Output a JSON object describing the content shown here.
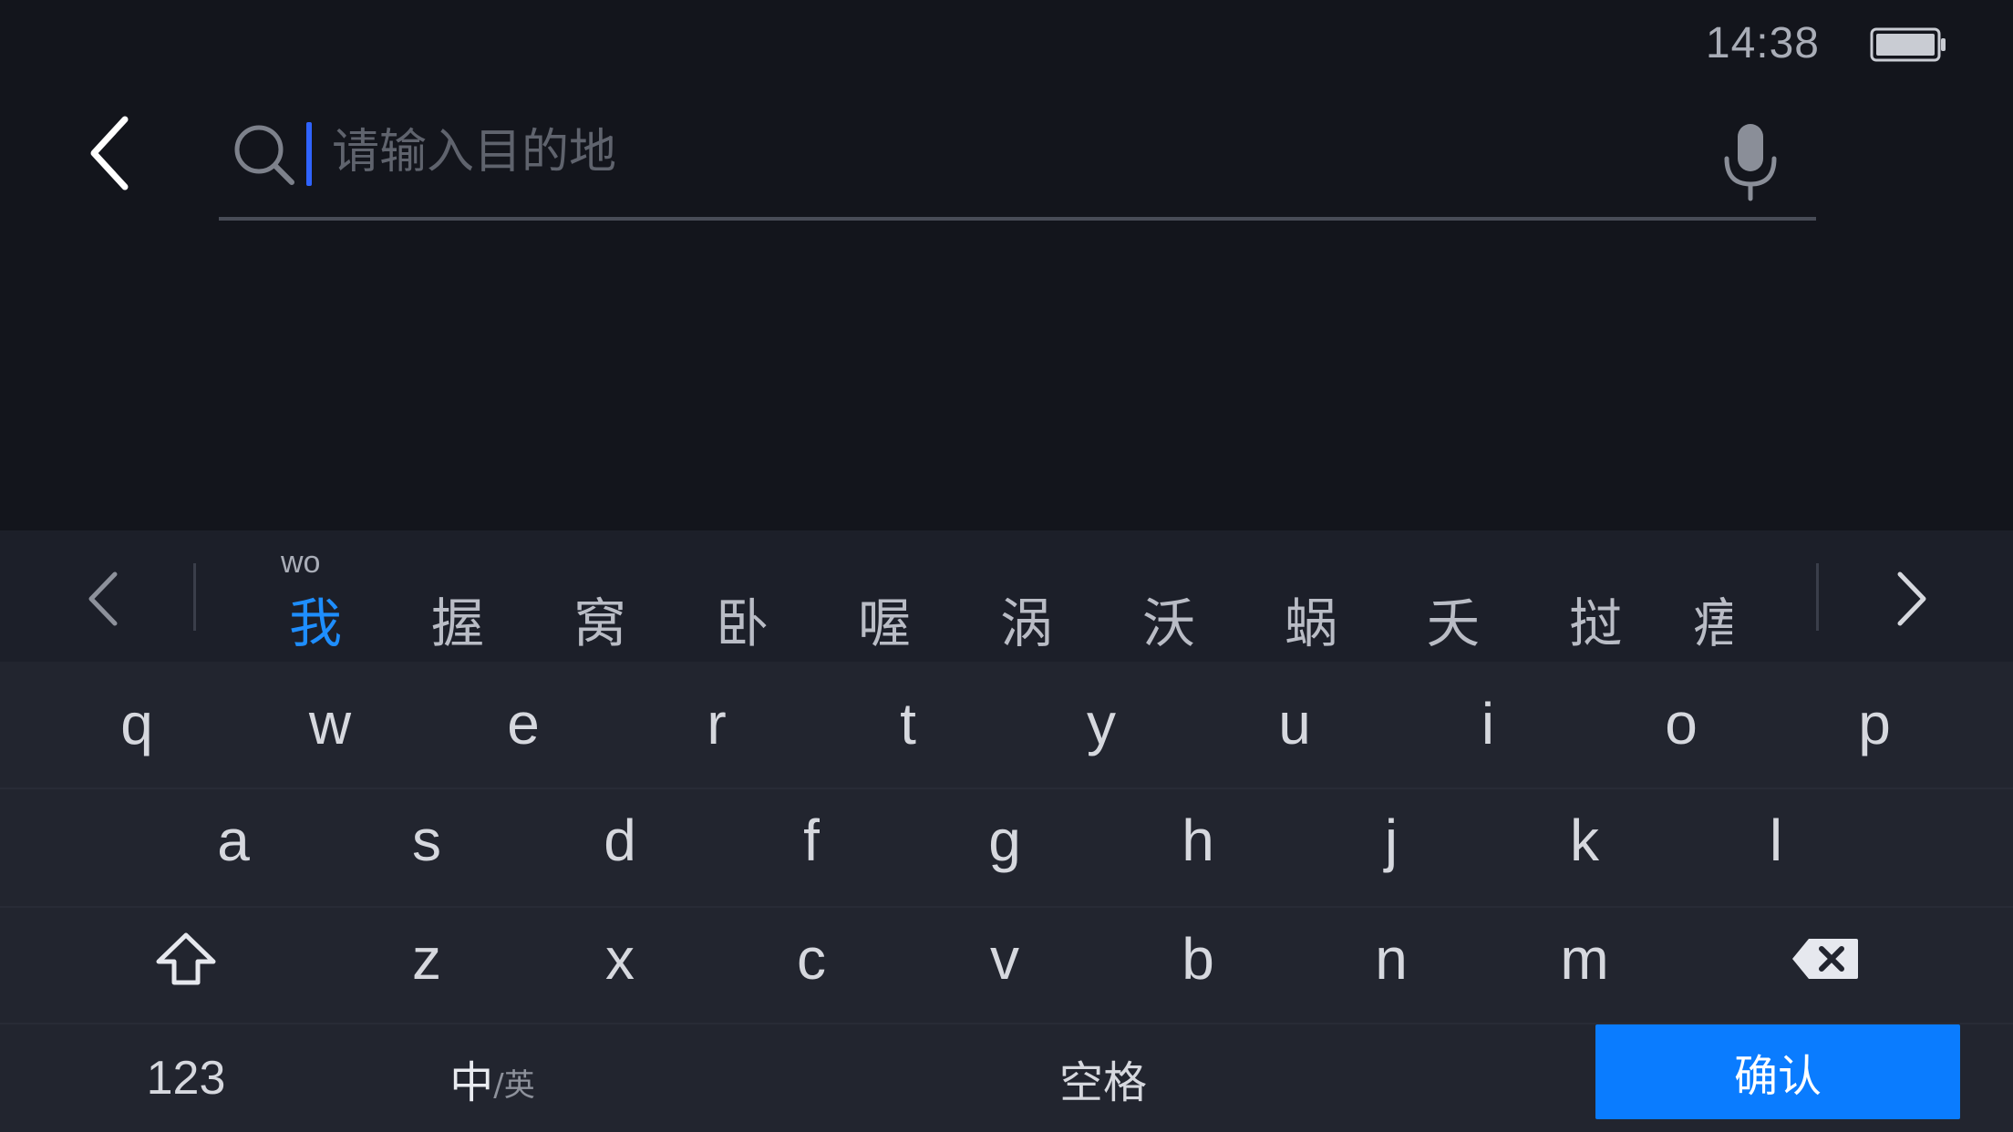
{
  "status_bar": {
    "time": "14:38"
  },
  "search": {
    "placeholder": "请输入目的地",
    "value": ""
  },
  "candidate_bar": {
    "pinyin": "wo",
    "candidates": [
      "我",
      "握",
      "窝",
      "卧",
      "喔",
      "涡",
      "沃",
      "蜗",
      "夭",
      "挝",
      "痦"
    ]
  },
  "keyboard": {
    "row1": [
      "q",
      "w",
      "e",
      "r",
      "t",
      "y",
      "u",
      "i",
      "o",
      "p"
    ],
    "row2": [
      "a",
      "s",
      "d",
      "f",
      "g",
      "h",
      "j",
      "k",
      "l"
    ],
    "row3": [
      "z",
      "x",
      "c",
      "v",
      "b",
      "n",
      "m"
    ],
    "numbers_label": "123",
    "mode_primary": "中",
    "mode_secondary": "/英",
    "space_label": "空格",
    "confirm_label": "确认"
  },
  "colors": {
    "background": "#13151c",
    "keyboard": "#22252f",
    "accent": "#0a7cff",
    "active_candidate": "#1e8eff",
    "caret": "#2f63ff"
  },
  "icons": [
    "battery-icon",
    "back-arrow-icon",
    "search-icon",
    "microphone-icon",
    "chevron-left-icon",
    "chevron-right-icon",
    "shift-icon",
    "backspace-icon"
  ]
}
